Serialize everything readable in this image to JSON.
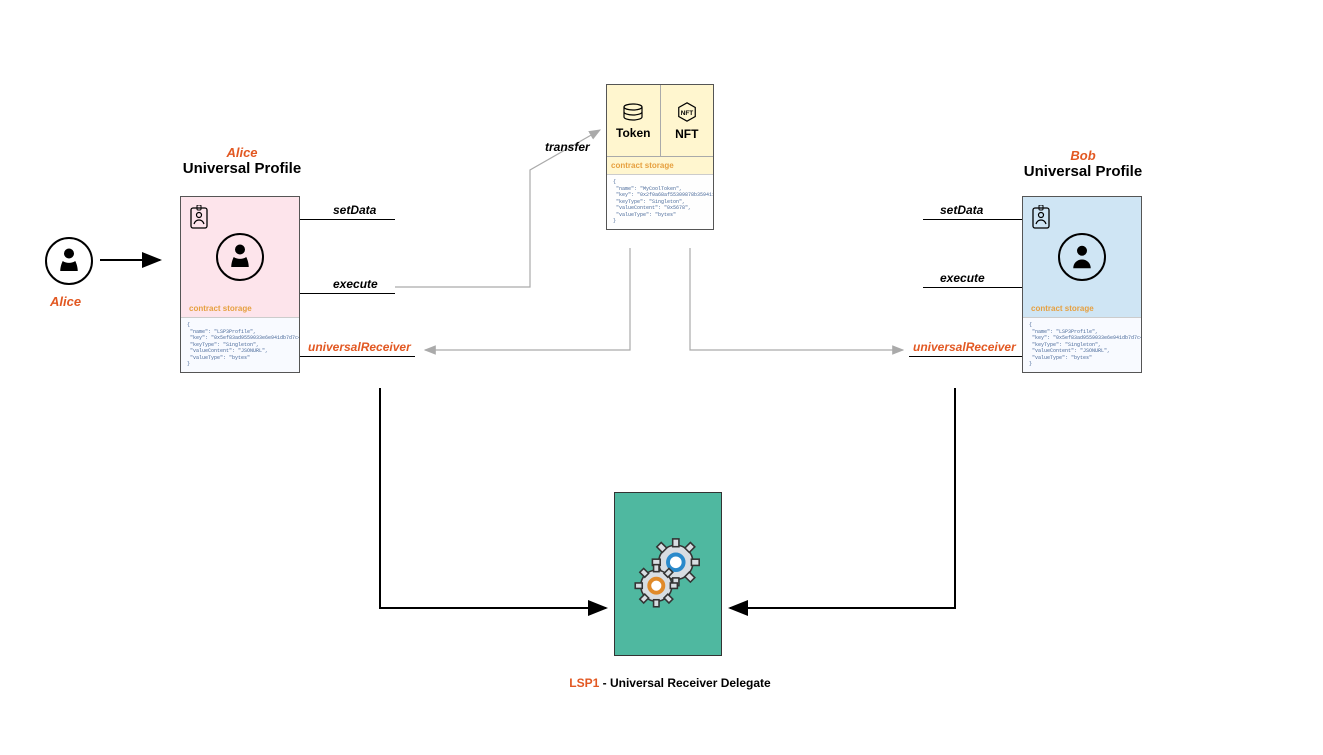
{
  "actors": {
    "alice_name": "Alice",
    "bob_name": "Bob",
    "profile_subtitle": "Universal Profile"
  },
  "token_box": {
    "token_label": "Token",
    "nft_label": "NFT",
    "storage_label": "contract storage",
    "code": "{\n \"name\": \"MyCoolToken\",\n \"key\": \"0x2f0a68af55309878b3594111e15d6f...\",\n \"keyType\": \"Singleton\",\n \"valueContent\": \"0x5678\",\n \"valueType\": \"bytes\"\n}"
  },
  "profile": {
    "storage_label": "contract storage",
    "alice_code": "{\n \"name\": \"LSP3Profile\",\n \"key\": \"0x5ef83ad9559033e6e941db7d7c495...\",\n \"keyType\": \"Singleton\",\n \"valueContent\": \"JSONURL\",\n \"valueType\": \"bytes\"\n}",
    "bob_code": "{\n \"name\": \"LSP3Profile\",\n \"key\": \"0x5ef83ad9559033e6e941db7d7c495...\",\n \"keyType\": \"Singleton\",\n \"valueContent\": \"JSONURL\",\n \"valueType\": \"bytes\"\n}"
  },
  "methods": {
    "setData": "setData",
    "execute": "execute",
    "universalReceiver": "universalReceiver",
    "transfer": "transfer"
  },
  "delegate": {
    "lsp1": "LSP1",
    "rest": " - Universal Receiver Delegate"
  }
}
